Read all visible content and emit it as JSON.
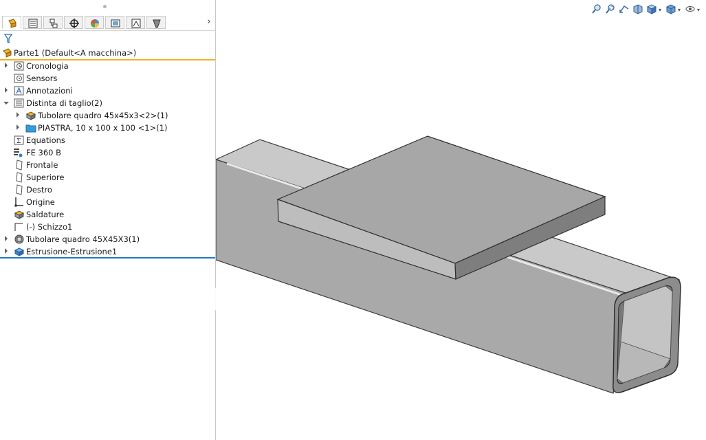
{
  "tree": {
    "root_label": "Parte1 (Default<A macchina>)",
    "items": [
      {
        "label": "Cronologia",
        "icon": "history-icon"
      },
      {
        "label": "Sensors",
        "icon": "sensors-icon"
      },
      {
        "label": "Annotazioni",
        "icon": "annotations-icon"
      },
      {
        "label": "Distinta di taglio(2)",
        "icon": "cut-list-icon"
      },
      {
        "label": "Tubolare quadro 45x45x3<2>(1)",
        "icon": "weldment-tube-icon"
      },
      {
        "label": "PIASTRA, 10 x 100 x 100 <1>(1)",
        "icon": "folder-icon"
      },
      {
        "label": "Equations",
        "icon": "equations-icon"
      },
      {
        "label": "FE 360 B",
        "icon": "material-icon"
      },
      {
        "label": "Frontale",
        "icon": "plane-icon"
      },
      {
        "label": "Superiore",
        "icon": "plane-icon"
      },
      {
        "label": "Destro",
        "icon": "plane-icon"
      },
      {
        "label": "Origine",
        "icon": "origin-icon"
      },
      {
        "label": "Saldature",
        "icon": "welds-icon"
      },
      {
        "label": "(-) Schizzo1",
        "icon": "sketch-icon"
      },
      {
        "label": "Tubolare quadro 45X45X3(1)",
        "icon": "structural-member-icon"
      },
      {
        "label": "Estrusione-Estrusione1",
        "icon": "extrude-icon"
      }
    ]
  },
  "panel_tabs": [
    "feature-manager-icon",
    "property-manager-icon",
    "configuration-manager-icon",
    "dimxpert-icon",
    "display-manager-icon",
    "cam-icon",
    "drawing-icon",
    "weldment-icon"
  ],
  "view_toolbar": [
    "zoom-to-fit-icon",
    "zoom-to-area-icon",
    "previous-view-icon",
    "section-view-icon",
    "view-orientation-icon",
    "display-style-icon",
    "hide-show-icon"
  ],
  "colors": {
    "accent_root": "#f0b323",
    "accent_bottom": "#1f78c8",
    "model_light": "#c8c8c8",
    "model_mid": "#a9a9a9",
    "model_dark": "#7e7e7e"
  }
}
